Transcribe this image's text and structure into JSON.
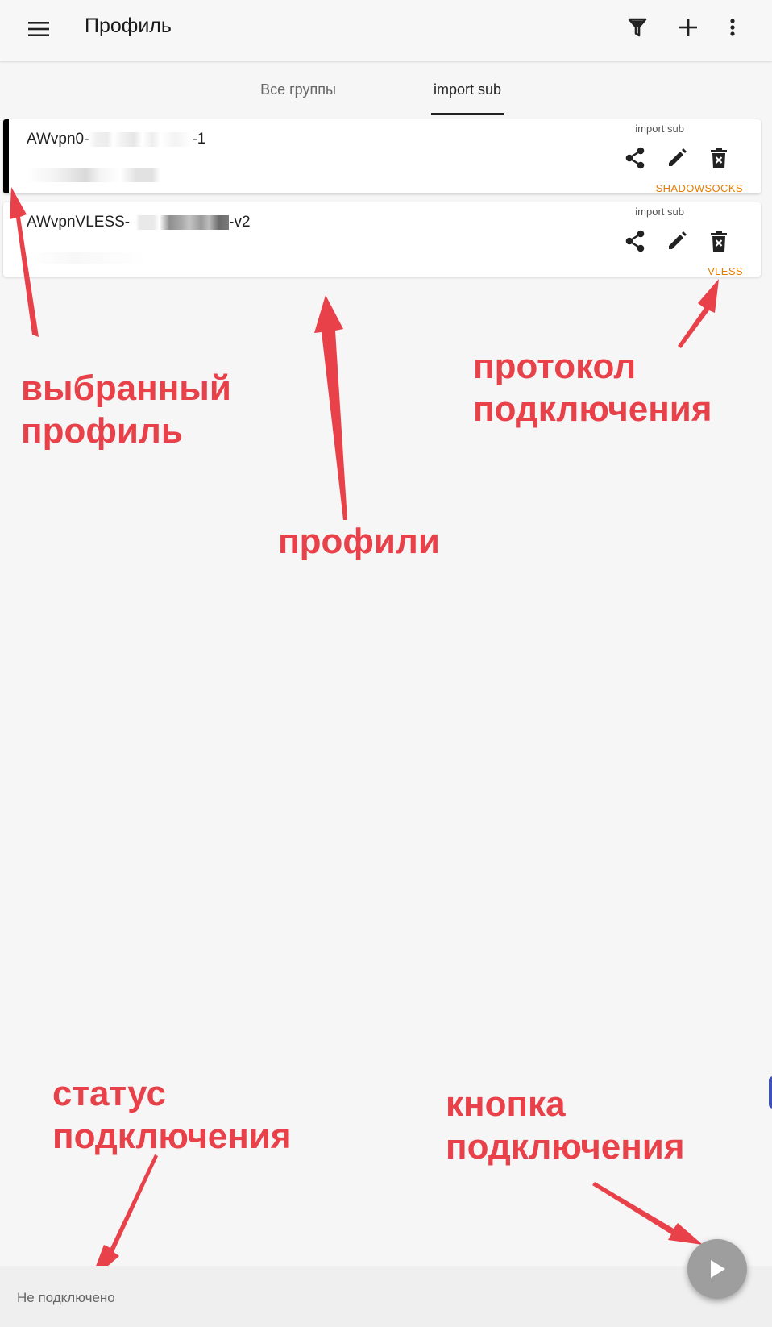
{
  "appbar": {
    "title": "Профиль",
    "icons": [
      "menu-icon",
      "filter-icon",
      "add-icon",
      "more-vert-icon"
    ]
  },
  "tabs": [
    {
      "label": "Все группы",
      "active": false
    },
    {
      "label": "import sub",
      "active": true
    }
  ],
  "profiles": [
    {
      "name_prefix": "AWvpn0-",
      "name_suffix": "-1",
      "group": "import sub",
      "protocol": "SHADOWSOCKS",
      "selected": true
    },
    {
      "name_prefix": "AWvpnVLESS-",
      "name_suffix": "-v2",
      "group": "import sub",
      "protocol": "VLESS",
      "selected": false
    }
  ],
  "status": {
    "text": "Не подключено"
  },
  "annotations": {
    "selected_profile": "выбранный\nпрофиль",
    "protocol": "протокол\nподключения",
    "profiles": "профили",
    "status": "статус\nподключения",
    "connect_button": "кнопка\nподключения"
  },
  "colors": {
    "annotation": "#e8414a",
    "protocol": "#e67e00",
    "fab": "#9e9e9e"
  }
}
